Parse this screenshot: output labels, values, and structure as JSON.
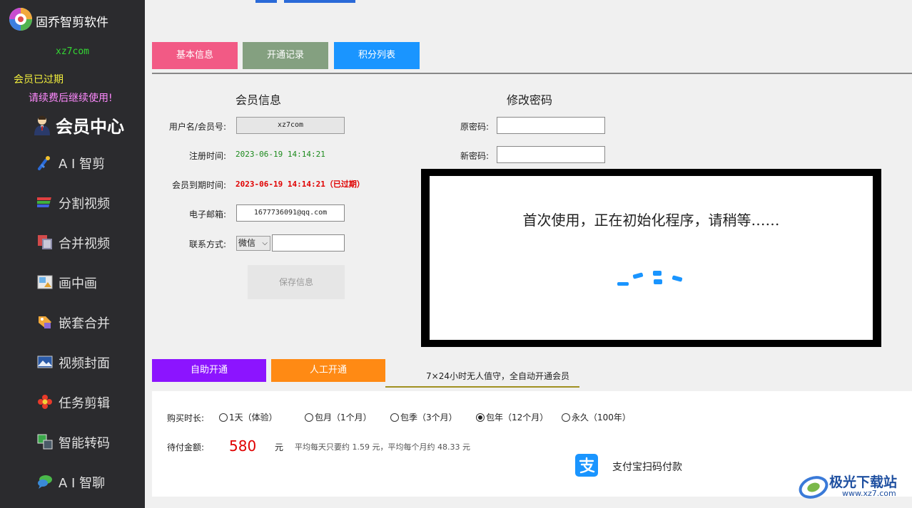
{
  "app": {
    "title": "固乔智剪软件",
    "site": "xz7com"
  },
  "status": {
    "expired": "会员已过期",
    "renew": "请续费后继续使用!"
  },
  "sidebar": {
    "header_label": "会员中心",
    "items": [
      {
        "label": "A I 智剪",
        "icon": "ai-cut-icon"
      },
      {
        "label": "分割视频",
        "icon": "split-video-icon"
      },
      {
        "label": "合并视频",
        "icon": "merge-video-icon"
      },
      {
        "label": "画中画",
        "icon": "picture-in-picture-icon"
      },
      {
        "label": "嵌套合并",
        "icon": "nested-merge-icon"
      },
      {
        "label": "视频封面",
        "icon": "video-cover-icon"
      },
      {
        "label": "任务剪辑",
        "icon": "task-edit-icon"
      },
      {
        "label": "智能转码",
        "icon": "smart-transcode-icon"
      },
      {
        "label": "A I 智聊",
        "icon": "ai-chat-icon"
      }
    ]
  },
  "tabs": {
    "basic": "基本信息",
    "record": "开通记录",
    "points": "积分列表"
  },
  "member_info": {
    "title": "会员信息",
    "username_label": "用户名/会员号:",
    "username_value": "xz7com",
    "reg_label": "注册时间:",
    "reg_value": "2023-06-19 14:14:21",
    "expire_label": "会员到期时间:",
    "expire_value": "2023-06-19 14:14:21（已过期）",
    "email_label": "电子邮箱:",
    "email_value": "1677736091@qq.com",
    "contact_label": "联系方式:",
    "contact_selected": "微信",
    "contact_value": "",
    "save_label": "保存信息"
  },
  "password": {
    "title": "修改密码",
    "old_label": "原密码:",
    "new_label": "新密码:",
    "old_value": "",
    "new_value": ""
  },
  "loading": {
    "message": "首次使用，正在初始化程序，请稍等……"
  },
  "purchase": {
    "self_tab": "自助开通",
    "manual_tab": "人工开通",
    "note": "7×24小时无人值守，全自动开通会员",
    "duration_label": "购买时长:",
    "options": [
      {
        "label": "1天（体验）",
        "selected": false
      },
      {
        "label": "包月（1个月）",
        "selected": false
      },
      {
        "label": "包季（3个月）",
        "selected": false
      },
      {
        "label": "包年（12个月）",
        "selected": true
      },
      {
        "label": "永久（100年）",
        "selected": false
      }
    ],
    "amount_label": "待付金额:",
    "amount": "580",
    "unit": "元",
    "average": "平均每天只要约 1.59 元，平均每个月约 48.33 元",
    "alipay_label": "支付宝扫码付款"
  },
  "watermark": {
    "text": "极光下载站",
    "url": "www.xz7.com"
  },
  "colors": {
    "sidebar_bg": "#2b2b2e",
    "tab_basic": "#f25a85",
    "tab_record": "#84a080",
    "tab_points": "#1a95ff",
    "tab_self": "#8c14ff",
    "tab_manual": "#ff8a14",
    "alipay": "#1a95ff",
    "expired_red": "#e00000"
  }
}
